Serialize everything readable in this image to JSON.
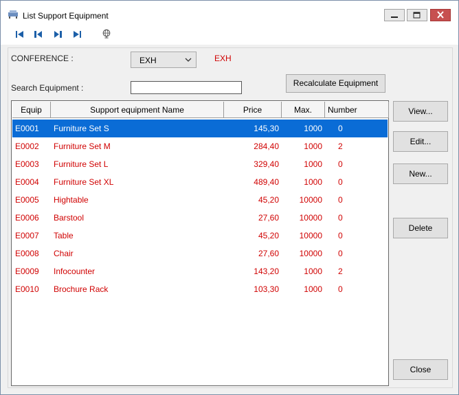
{
  "window": {
    "title": "List Support Equipment",
    "controls": {
      "minimize": "minimize-icon",
      "maximize": "maximize-icon",
      "close": "close-icon"
    }
  },
  "toolbar": {
    "icons": [
      "first-record-icon",
      "previous-record-icon",
      "next-record-icon",
      "last-record-icon",
      "globe-icon"
    ]
  },
  "form": {
    "conference_label": "CONFERENCE :",
    "conference_selected": "EXH",
    "conference_value_text": "EXH",
    "search_label": "Search Equipment :",
    "search_value": "",
    "recalculate_label": "Recalculate Equipment"
  },
  "table": {
    "columns": [
      "Equip",
      "Support equipment Name",
      "Price",
      "Max.",
      "Number"
    ],
    "rows": [
      {
        "equip": "E0001",
        "name": "Furniture Set S",
        "price": "145,30",
        "max": "1000",
        "number": "0",
        "selected": true
      },
      {
        "equip": "E0002",
        "name": "Furniture Set M",
        "price": "284,40",
        "max": "1000",
        "number": "2"
      },
      {
        "equip": "E0003",
        "name": "Furniture Set L",
        "price": "329,40",
        "max": "1000",
        "number": "0"
      },
      {
        "equip": "E0004",
        "name": "Furniture Set XL",
        "price": "489,40",
        "max": "1000",
        "number": "0"
      },
      {
        "equip": "E0005",
        "name": "Hightable",
        "price": "45,20",
        "max": "10000",
        "number": "0"
      },
      {
        "equip": "E0006",
        "name": "Barstool",
        "price": "27,60",
        "max": "10000",
        "number": "0"
      },
      {
        "equip": "E0007",
        "name": "Table",
        "price": "45,20",
        "max": "10000",
        "number": "0"
      },
      {
        "equip": "E0008",
        "name": "Chair",
        "price": "27,60",
        "max": "10000",
        "number": "0"
      },
      {
        "equip": "E0009",
        "name": "Infocounter",
        "price": "143,20",
        "max": "1000",
        "number": "2"
      },
      {
        "equip": "E0010",
        "name": "Brochure Rack",
        "price": "103,30",
        "max": "1000",
        "number": "0"
      }
    ]
  },
  "actions": {
    "view": "View...",
    "edit": "Edit...",
    "new": "New...",
    "delete": "Delete",
    "close": "Close"
  },
  "colors": {
    "row_text": "#d00000",
    "selection": "#0a6cd6",
    "close_button": "#c75050"
  }
}
